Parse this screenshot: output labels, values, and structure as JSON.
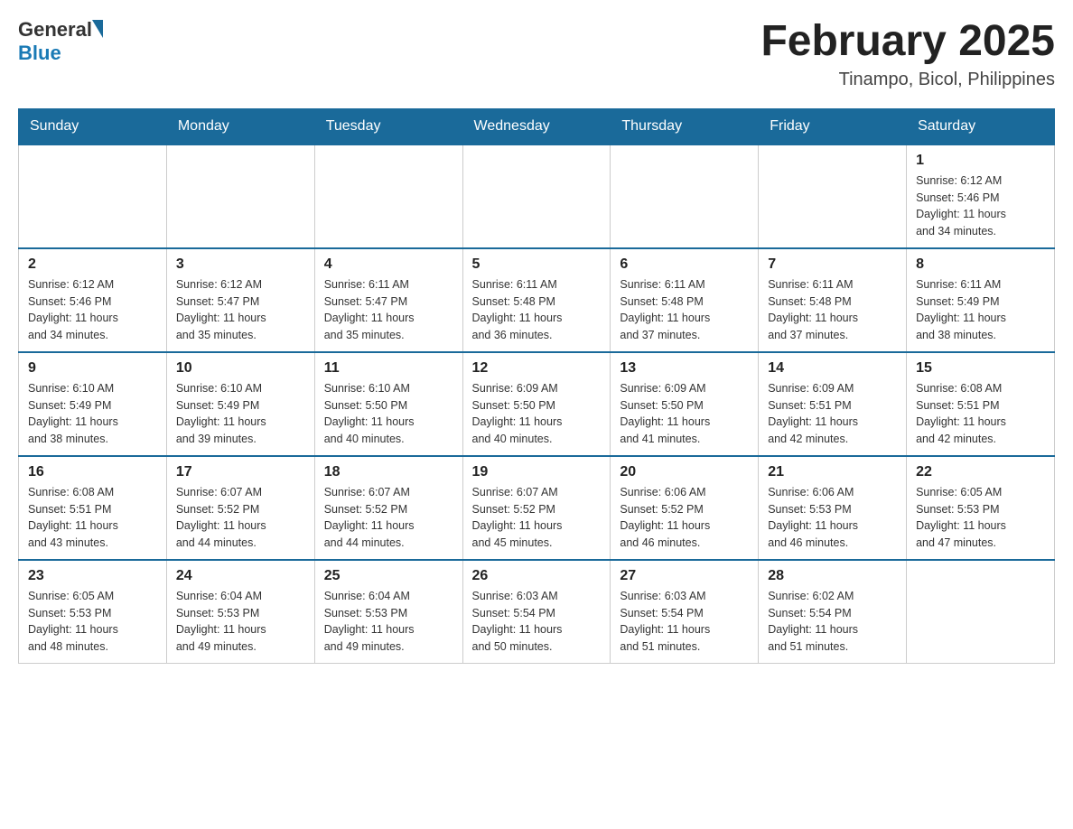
{
  "header": {
    "logo_general": "General",
    "logo_blue": "Blue",
    "month_title": "February 2025",
    "location": "Tinampo, Bicol, Philippines"
  },
  "days_of_week": [
    "Sunday",
    "Monday",
    "Tuesday",
    "Wednesday",
    "Thursday",
    "Friday",
    "Saturday"
  ],
  "weeks": [
    [
      {
        "day": "",
        "info": ""
      },
      {
        "day": "",
        "info": ""
      },
      {
        "day": "",
        "info": ""
      },
      {
        "day": "",
        "info": ""
      },
      {
        "day": "",
        "info": ""
      },
      {
        "day": "",
        "info": ""
      },
      {
        "day": "1",
        "info": "Sunrise: 6:12 AM\nSunset: 5:46 PM\nDaylight: 11 hours\nand 34 minutes."
      }
    ],
    [
      {
        "day": "2",
        "info": "Sunrise: 6:12 AM\nSunset: 5:46 PM\nDaylight: 11 hours\nand 34 minutes."
      },
      {
        "day": "3",
        "info": "Sunrise: 6:12 AM\nSunset: 5:47 PM\nDaylight: 11 hours\nand 35 minutes."
      },
      {
        "day": "4",
        "info": "Sunrise: 6:11 AM\nSunset: 5:47 PM\nDaylight: 11 hours\nand 35 minutes."
      },
      {
        "day": "5",
        "info": "Sunrise: 6:11 AM\nSunset: 5:48 PM\nDaylight: 11 hours\nand 36 minutes."
      },
      {
        "day": "6",
        "info": "Sunrise: 6:11 AM\nSunset: 5:48 PM\nDaylight: 11 hours\nand 37 minutes."
      },
      {
        "day": "7",
        "info": "Sunrise: 6:11 AM\nSunset: 5:48 PM\nDaylight: 11 hours\nand 37 minutes."
      },
      {
        "day": "8",
        "info": "Sunrise: 6:11 AM\nSunset: 5:49 PM\nDaylight: 11 hours\nand 38 minutes."
      }
    ],
    [
      {
        "day": "9",
        "info": "Sunrise: 6:10 AM\nSunset: 5:49 PM\nDaylight: 11 hours\nand 38 minutes."
      },
      {
        "day": "10",
        "info": "Sunrise: 6:10 AM\nSunset: 5:49 PM\nDaylight: 11 hours\nand 39 minutes."
      },
      {
        "day": "11",
        "info": "Sunrise: 6:10 AM\nSunset: 5:50 PM\nDaylight: 11 hours\nand 40 minutes."
      },
      {
        "day": "12",
        "info": "Sunrise: 6:09 AM\nSunset: 5:50 PM\nDaylight: 11 hours\nand 40 minutes."
      },
      {
        "day": "13",
        "info": "Sunrise: 6:09 AM\nSunset: 5:50 PM\nDaylight: 11 hours\nand 41 minutes."
      },
      {
        "day": "14",
        "info": "Sunrise: 6:09 AM\nSunset: 5:51 PM\nDaylight: 11 hours\nand 42 minutes."
      },
      {
        "day": "15",
        "info": "Sunrise: 6:08 AM\nSunset: 5:51 PM\nDaylight: 11 hours\nand 42 minutes."
      }
    ],
    [
      {
        "day": "16",
        "info": "Sunrise: 6:08 AM\nSunset: 5:51 PM\nDaylight: 11 hours\nand 43 minutes."
      },
      {
        "day": "17",
        "info": "Sunrise: 6:07 AM\nSunset: 5:52 PM\nDaylight: 11 hours\nand 44 minutes."
      },
      {
        "day": "18",
        "info": "Sunrise: 6:07 AM\nSunset: 5:52 PM\nDaylight: 11 hours\nand 44 minutes."
      },
      {
        "day": "19",
        "info": "Sunrise: 6:07 AM\nSunset: 5:52 PM\nDaylight: 11 hours\nand 45 minutes."
      },
      {
        "day": "20",
        "info": "Sunrise: 6:06 AM\nSunset: 5:52 PM\nDaylight: 11 hours\nand 46 minutes."
      },
      {
        "day": "21",
        "info": "Sunrise: 6:06 AM\nSunset: 5:53 PM\nDaylight: 11 hours\nand 46 minutes."
      },
      {
        "day": "22",
        "info": "Sunrise: 6:05 AM\nSunset: 5:53 PM\nDaylight: 11 hours\nand 47 minutes."
      }
    ],
    [
      {
        "day": "23",
        "info": "Sunrise: 6:05 AM\nSunset: 5:53 PM\nDaylight: 11 hours\nand 48 minutes."
      },
      {
        "day": "24",
        "info": "Sunrise: 6:04 AM\nSunset: 5:53 PM\nDaylight: 11 hours\nand 49 minutes."
      },
      {
        "day": "25",
        "info": "Sunrise: 6:04 AM\nSunset: 5:53 PM\nDaylight: 11 hours\nand 49 minutes."
      },
      {
        "day": "26",
        "info": "Sunrise: 6:03 AM\nSunset: 5:54 PM\nDaylight: 11 hours\nand 50 minutes."
      },
      {
        "day": "27",
        "info": "Sunrise: 6:03 AM\nSunset: 5:54 PM\nDaylight: 11 hours\nand 51 minutes."
      },
      {
        "day": "28",
        "info": "Sunrise: 6:02 AM\nSunset: 5:54 PM\nDaylight: 11 hours\nand 51 minutes."
      },
      {
        "day": "",
        "info": ""
      }
    ]
  ]
}
